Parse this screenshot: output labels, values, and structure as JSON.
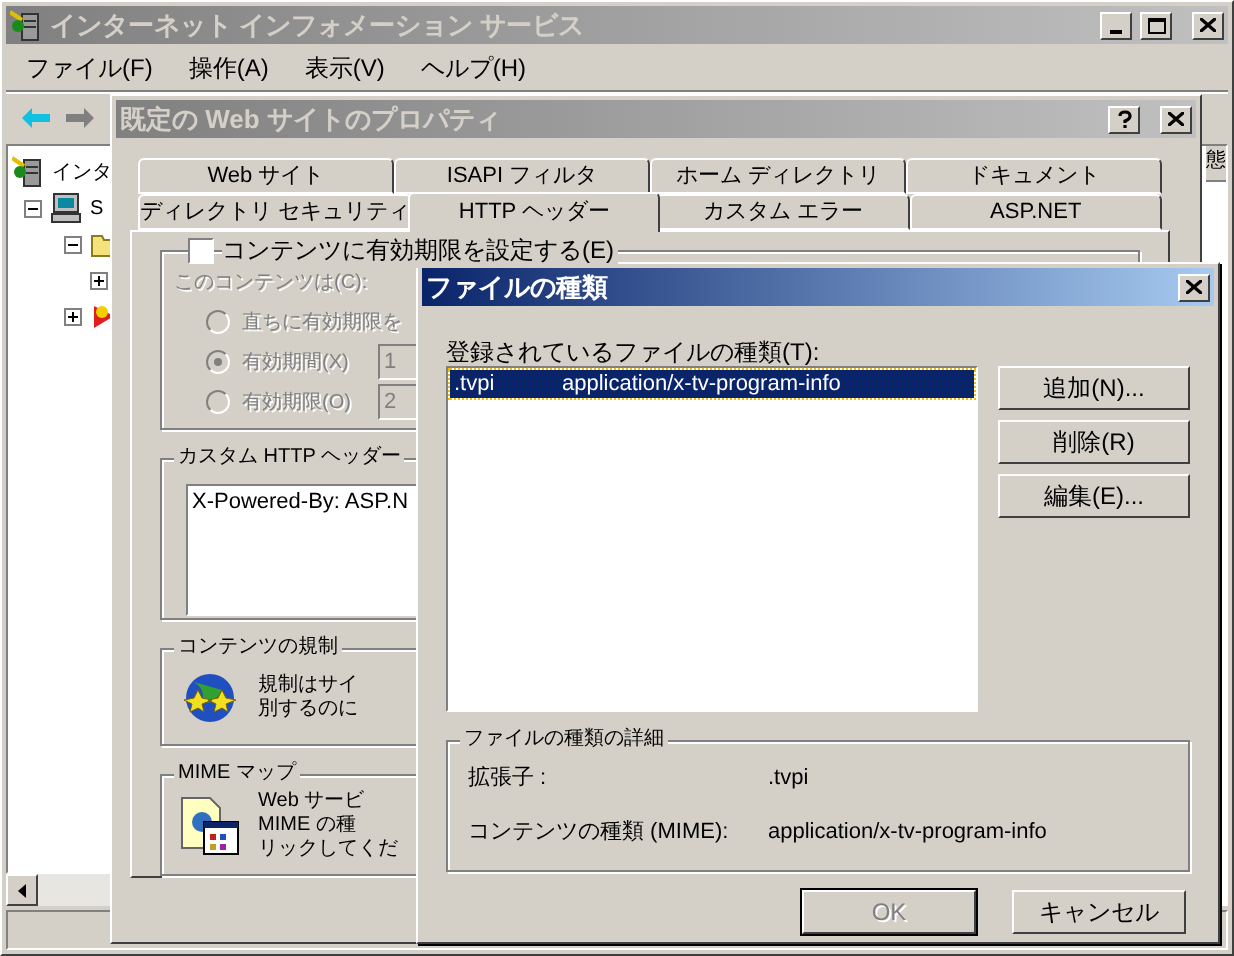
{
  "main_window": {
    "title": "インターネット インフォメーション サービス",
    "active": false,
    "menu": [
      "ファイル(F)",
      "操作(A)",
      "表示(V)",
      "ヘルプ(H)"
    ],
    "tree": [
      {
        "kind": "server",
        "label": "インタ",
        "children": [
          {
            "kind": "computer",
            "label": "S",
            "expanded": true,
            "children": [
              {
                "kind": "folder",
                "expanded": true,
                "children": [
                  {
                    "expanded": false
                  }
                ]
              },
              {
                "kind": "site",
                "expanded": false
              }
            ]
          }
        ]
      }
    ],
    "list_columns": [
      "態"
    ]
  },
  "properties_dialog": {
    "title": "既定の Web サイトのプロパティ",
    "active": false,
    "tab_rows": [
      [
        {
          "label": "Web サイト",
          "selected": false
        },
        {
          "label": "ISAPI フィルタ",
          "selected": false
        },
        {
          "label": "ホーム ディレクトリ",
          "selected": false
        },
        {
          "label": "ドキュメント",
          "selected": false
        }
      ],
      [
        {
          "label": "ディレクトリ セキュリティ",
          "selected": false
        },
        {
          "label": "HTTP ヘッダー",
          "selected": true
        },
        {
          "label": "カスタム エラー",
          "selected": false
        },
        {
          "label": "ASP.NET",
          "selected": false
        }
      ]
    ],
    "expiry": {
      "label": "コンテンツに有効期限を設定する(E)",
      "checked": false,
      "disabled": true,
      "prompt": "このコンテンツは(C):",
      "options": [
        {
          "label": "直ちに有効期限を",
          "selected": false
        },
        {
          "label": "有効期間(X)",
          "selected": true,
          "value": "1"
        },
        {
          "label": "有効期限(O)",
          "selected": false,
          "value": "2"
        }
      ]
    },
    "custom_headers": {
      "title": "カスタム HTTP ヘッダー",
      "items": [
        "X-Powered-By: ASP.N"
      ]
    },
    "ratings": {
      "title": "コンテンツの規制",
      "lines": [
        "規制はサイ",
        "別するのに"
      ]
    },
    "mime_map": {
      "title": "MIME マップ",
      "lines": [
        "Web サービ",
        "MIME の種",
        "リックしてくだ"
      ]
    }
  },
  "file_types_dialog": {
    "title": "ファイルの種類",
    "active": true,
    "list_label": "登録されているファイルの種類(T):",
    "types": [
      {
        "extension": ".tvpi",
        "mime": "application/x-tv-program-info",
        "selected": true
      }
    ],
    "side_buttons": [
      "追加(N)...",
      "削除(R)",
      "編集(E)..."
    ],
    "details": {
      "title": "ファイルの種類の詳細",
      "rows": [
        {
          "label": "拡張子 :",
          "value": ".tvpi"
        },
        {
          "label": "コンテンツの種類 (MIME):",
          "value": "application/x-tv-program-info"
        }
      ]
    },
    "buttons": [
      {
        "label": "OK",
        "disabled": true,
        "default": true
      },
      {
        "label": "キャンセル",
        "disabled": false,
        "default": false
      }
    ]
  }
}
